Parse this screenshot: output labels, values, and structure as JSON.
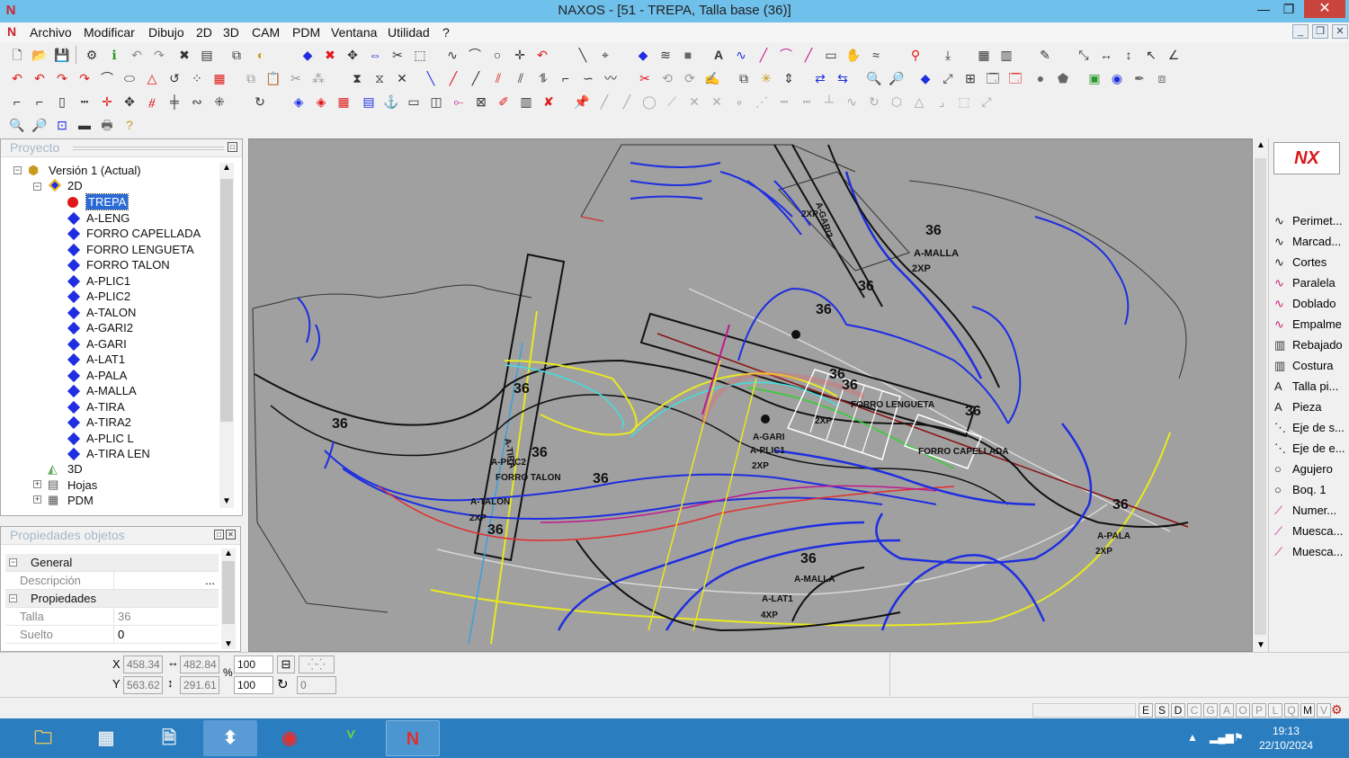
{
  "window": {
    "title": "NAXOS - [51 - TREPA, Talla base (36)]",
    "app_icon": "N",
    "min": "—",
    "restore": "❐",
    "close": "✕"
  },
  "menu": {
    "items": [
      "Archivo",
      "Modificar",
      "Dibujo",
      "2D",
      "3D",
      "CAM",
      "PDM",
      "Ventana",
      "Utilidad",
      "?"
    ],
    "mdi_min": "_",
    "mdi_restore": "❐",
    "mdi_close": "✕"
  },
  "project_panel": {
    "header": "Proyecto",
    "version_label": "Versión 1 (Actual)",
    "node_2d": "2D",
    "pieces": [
      "TREPA",
      "A-LENG",
      "FORRO CAPELLADA",
      "FORRO LENGUETA",
      "FORRO TALON",
      "A-PLIC1",
      "A-PLIC2",
      "A-TALON",
      "A-GARI2",
      "A-GARI",
      "A-LAT1",
      "A-PALA",
      "A-MALLA",
      "A-TIRA",
      "A-TIRA2",
      "A-PLIC L",
      "A-TIRA LEN"
    ],
    "node_3d": "3D",
    "node_hojas": "Hojas",
    "node_pdm": "PDM",
    "selected": "TREPA"
  },
  "properties_panel": {
    "header": "Propiedades objetos",
    "group_general": "General",
    "desc_label": "Descripción",
    "desc_btn": "...",
    "group_props": "Propiedades",
    "talla_label": "Talla",
    "talla_value": "36",
    "suelto_label": "Suelto",
    "suelto_value": "0"
  },
  "coords": {
    "x_label": "X",
    "y_label": "Y",
    "x_value": "458.34",
    "y_value": "563.62",
    "w_value": "482.84",
    "h_value": "291.61",
    "pct_label": "%",
    "scale_x": "100",
    "scale_y": "100",
    "rotation": "0"
  },
  "right_panel": {
    "logo": "NX",
    "commands": [
      {
        "icon": "curve-icon",
        "label": "Perimet..."
      },
      {
        "icon": "curve-icon",
        "label": "Marcad..."
      },
      {
        "icon": "curve-icon",
        "label": "Cortes"
      },
      {
        "icon": "curve-pink-icon",
        "label": "Paralela"
      },
      {
        "icon": "curve-pink-icon",
        "label": "Doblado"
      },
      {
        "icon": "curve-pink-icon",
        "label": "Empalme"
      },
      {
        "icon": "hatch-icon",
        "label": "Rebajado"
      },
      {
        "icon": "hatch-icon",
        "label": "Costura"
      },
      {
        "icon": "text-icon",
        "label": "Talla pi..."
      },
      {
        "icon": "text-icon",
        "label": "Pieza"
      },
      {
        "icon": "dash-icon",
        "label": "Eje de s..."
      },
      {
        "icon": "dash-icon",
        "label": "Eje de e..."
      },
      {
        "icon": "circle-icon",
        "label": "Agujero"
      },
      {
        "icon": "circle-icon",
        "label": "Boq. 1"
      },
      {
        "icon": "number-icon",
        "label": "Numer..."
      },
      {
        "icon": "notch-icon",
        "label": "Muesca..."
      },
      {
        "icon": "notch-icon",
        "label": "Muesca..."
      }
    ]
  },
  "canvas_labels": [
    {
      "text": "36"
    },
    {
      "text": "A-MALLA"
    },
    {
      "text": "2XP"
    },
    {
      "text": "36"
    },
    {
      "text": "36"
    },
    {
      "text": "A-GARI2"
    },
    {
      "text": "2XP"
    },
    {
      "text": "36"
    },
    {
      "text": "36"
    },
    {
      "text": "FORRO LENGUETA"
    },
    {
      "text": "2XP"
    },
    {
      "text": "36"
    },
    {
      "text": "FORRO CAPELLADA"
    },
    {
      "text": "A-GARI"
    },
    {
      "text": "A-PLIC1"
    },
    {
      "text": "2XP"
    },
    {
      "text": "36"
    },
    {
      "text": "A-TIRA"
    },
    {
      "text": "36"
    },
    {
      "text": "A-PLIC2"
    },
    {
      "text": "FORRO TALON"
    },
    {
      "text": "36"
    },
    {
      "text": "A-TALON"
    },
    {
      "text": "2XP"
    },
    {
      "text": "36"
    },
    {
      "text": "36"
    },
    {
      "text": "A-MALLA"
    },
    {
      "text": "A-LAT1"
    },
    {
      "text": "4XP"
    },
    {
      "text": "36"
    },
    {
      "text": "A-PALA"
    },
    {
      "text": "2XP"
    },
    {
      "text": "36"
    }
  ],
  "status_flags": [
    "E",
    "S",
    "D",
    "C",
    "G",
    "A",
    "O",
    "P",
    "L",
    "Q",
    "M",
    "V"
  ],
  "taskbar": {
    "apps": [
      "file-explorer-icon",
      "calculator-icon",
      "documents-icon",
      "app-icon",
      "chrome-icon",
      "design-app-icon",
      "naxos-icon"
    ],
    "time": "19:13",
    "date": "22/10/2024",
    "tray_up": "▲"
  },
  "colors": {
    "titlebar": "#6fc0ea",
    "canvas": "#a0a0a0",
    "accent_blue": "#1e2ee0",
    "taskbar": "#2a7ec0",
    "close": "#c9443c"
  }
}
